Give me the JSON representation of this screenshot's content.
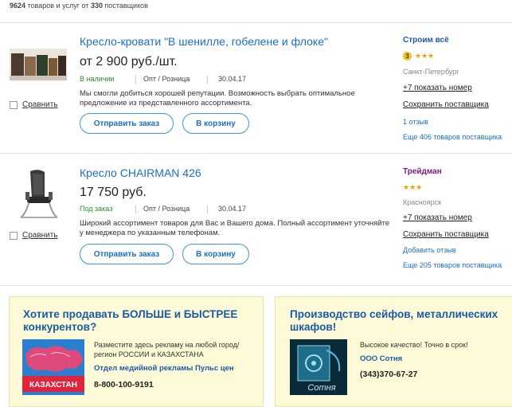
{
  "summary": {
    "count": "9624",
    "middle": " товаров и услуг от ",
    "suppliers": "330",
    "tail": " поставщиков"
  },
  "products": [
    {
      "title": "Кресло-кровати \"В шенилле, гобелене и флоке\"",
      "price": "от 2 900 руб./шт.",
      "stock": "В наличии",
      "wholesale": "Опт / Розница",
      "date": "30.04.17",
      "description": "Мы смогли добиться хорошей репутации. Возможность выбрать оптимальное предложение из представленного ассортимента.",
      "compare": "Сравнить",
      "order_btn": "Отправить заказ",
      "cart_btn": "В корзину",
      "supplier": {
        "name": "Строим всё",
        "name_color": "#1a5aa8",
        "level": "3",
        "stars": "★★★",
        "city": "Санкт-Петербург",
        "phone": "+7 показать номер",
        "save": "Сохранить поставщика",
        "reviews": "1 отзыв",
        "more": "Еще 406 товаров поставщика"
      }
    },
    {
      "title": "Кресло CHAIRMAN 426",
      "price": "17 750 руб.",
      "stock": "Под заказ",
      "wholesale": "Опт / Розница",
      "date": "30.04.17",
      "description": "Широкий ассортимент товаров для Вас и Вашего дома. Полный ассортимент уточняйте у менеджера по указанным телефонам.",
      "compare": "Сравнить",
      "order_btn": "Отправить заказ",
      "cart_btn": "В корзину",
      "supplier": {
        "name": "Трейдман",
        "name_color": "#7b1a7b",
        "level": "",
        "stars": "★★★",
        "city": "Красноярск",
        "phone": "+7 показать номер",
        "save": "Сохранить поставщика",
        "reviews": "Добавить отзыв",
        "more": "Еще 205 товаров поставщика"
      }
    }
  ],
  "ads": [
    {
      "title": "Хотите продавать БОЛЬШЕ и БЫСТРЕЕ конкурентов?",
      "text": "Разместите здесь рекламу на любой город/регион РОССИИ и КАЗАХСТАНА",
      "link": "Отдел медийной рекламы Пульс цен",
      "phone": "8-800-100-9191",
      "image_label": "КАЗАХСТАН"
    },
    {
      "title": "Производство сейфов, металлических шкафов!",
      "text": "Высокое качество! Точно в срок!",
      "link": "ООО Сотня",
      "phone": "(343)370-67-27",
      "image_label": "Сотня"
    }
  ]
}
